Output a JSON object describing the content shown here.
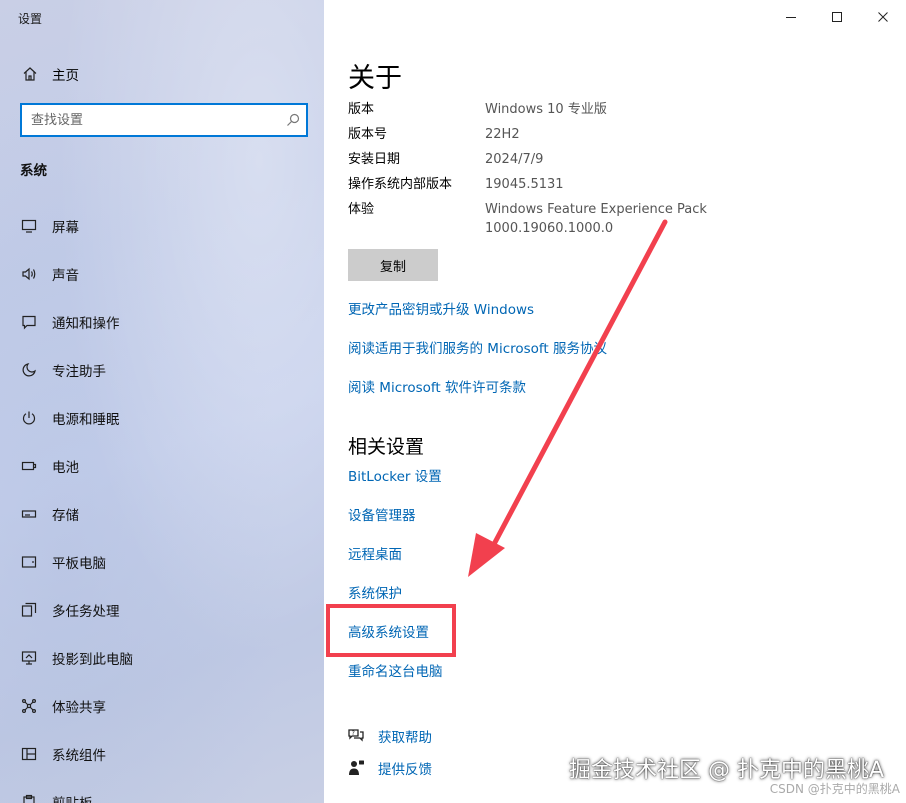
{
  "app": {
    "title": "设置"
  },
  "sidebar": {
    "home_label": "主页",
    "search_placeholder": "查找设置",
    "section_label": "系统",
    "items": [
      {
        "label": "屏幕",
        "icon": "monitor-icon"
      },
      {
        "label": "声音",
        "icon": "speaker-icon"
      },
      {
        "label": "通知和操作",
        "icon": "notification-icon"
      },
      {
        "label": "专注助手",
        "icon": "moon-icon"
      },
      {
        "label": "电源和睡眠",
        "icon": "power-icon"
      },
      {
        "label": "电池",
        "icon": "battery-icon"
      },
      {
        "label": "存储",
        "icon": "storage-icon"
      },
      {
        "label": "平板电脑",
        "icon": "tablet-icon"
      },
      {
        "label": "多任务处理",
        "icon": "multitask-icon"
      },
      {
        "label": "投影到此电脑",
        "icon": "project-icon"
      },
      {
        "label": "体验共享",
        "icon": "share-icon"
      },
      {
        "label": "系统组件",
        "icon": "components-icon"
      },
      {
        "label": "剪贴板",
        "icon": "clipboard-icon"
      }
    ]
  },
  "main": {
    "title": "关于",
    "specs": [
      {
        "key": "版本",
        "value": "Windows 10 专业版"
      },
      {
        "key": "版本号",
        "value": "22H2"
      },
      {
        "key": "安装日期",
        "value": "2024/7/9"
      },
      {
        "key": "操作系统内部版本",
        "value": "19045.5131"
      },
      {
        "key": "体验",
        "value": "Windows Feature Experience Pack 1000.19060.1000.0"
      }
    ],
    "copy_label": "复制",
    "links": [
      "更改产品密钥或升级 Windows",
      "阅读适用于我们服务的 Microsoft 服务协议",
      "阅读 Microsoft 软件许可条款"
    ],
    "related_title": "相关设置",
    "related_links": [
      "BitLocker 设置",
      "设备管理器",
      "远程桌面",
      "系统保护",
      "高级系统设置",
      "重命名这台电脑"
    ],
    "help": {
      "get_help": "获取帮助",
      "feedback": "提供反馈"
    }
  },
  "watermark": {
    "primary": "掘金技术社区 @ 扑克中的黑桃A",
    "secondary": "CSDN @扑克中的黑桃A"
  },
  "colors": {
    "accent": "#0078d7",
    "link": "#0066b4",
    "annotation": "#f2404e"
  }
}
